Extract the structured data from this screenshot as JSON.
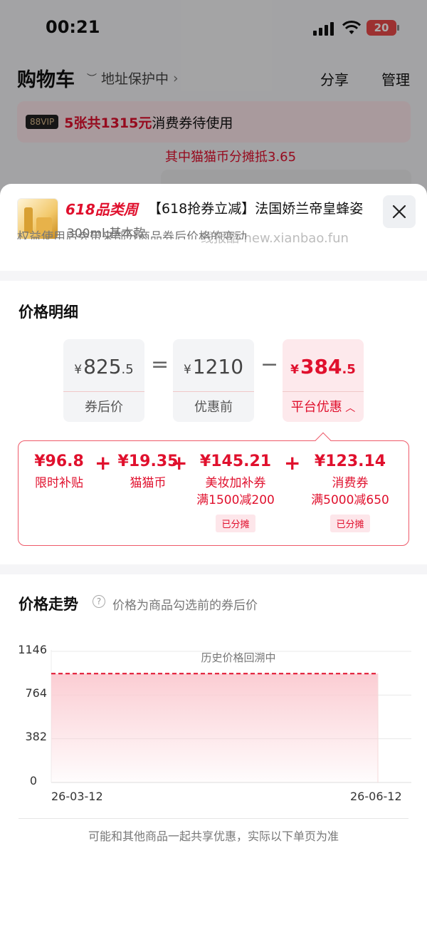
{
  "status_bar": {
    "time": "00:21",
    "battery": "20"
  },
  "cart": {
    "title": "购物车",
    "address": "地址保护中",
    "share": "分享",
    "manage": "管理",
    "vip_badge": "88VIP",
    "vip_highlight": "5张共1315元",
    "vip_rest": "消费券待使用",
    "coin_line": "其中猫猫币分摊抵3.65"
  },
  "product": {
    "tag": "618品类周",
    "name": "【618抢券立减】法国娇兰帝皇蜂姿",
    "sku": "300ml;基本款",
    "watermark": "线报酷-new.xianbao.fun",
    "clipped_text": "权益使用后会带来部分商品券后价格的变动"
  },
  "price_detail": {
    "title": "价格明细",
    "after_coupon": {
      "yen": "¥",
      "int": "825",
      "dec": ".5",
      "label": "券后价"
    },
    "before": {
      "yen": "¥",
      "int": "1210",
      "dec": "",
      "label": "优惠前"
    },
    "platform": {
      "yen": "¥",
      "int": "384",
      "dec": ".5",
      "label": "平台优惠"
    },
    "eq": "=",
    "minus": "−",
    "breakdown": [
      {
        "amount": "¥96.8",
        "line1": "限时补贴",
        "line2": "",
        "badge": ""
      },
      {
        "amount": "¥19.35",
        "line1": "猫猫币",
        "line2": "",
        "badge": ""
      },
      {
        "amount": "¥145.21",
        "line1": "美妆加补券",
        "line2": "满1500减200",
        "badge": "已分摊"
      },
      {
        "amount": "¥123.14",
        "line1": "消费券",
        "line2": "满5000减650",
        "badge": "已分摊"
      }
    ],
    "plus": "+"
  },
  "trend": {
    "title": "价格走势",
    "help": "?",
    "note": "价格为商品勾选前的券后价",
    "footnote": "可能和其他商品一起共享优惠，实际以下单页为准"
  },
  "chart_data": {
    "type": "area",
    "annotation": "历史价格回溯中",
    "y_ticks": [
      "1146",
      "764",
      "382",
      "0"
    ],
    "ylim": [
      0,
      1146
    ],
    "x_ticks": [
      "26-03-12",
      "26-06-12"
    ],
    "x": [
      "26-03-12",
      "26-06-12"
    ],
    "values": [
      951,
      951
    ],
    "line_color": "#e0102d",
    "fill_color": "#fbcdd3"
  }
}
